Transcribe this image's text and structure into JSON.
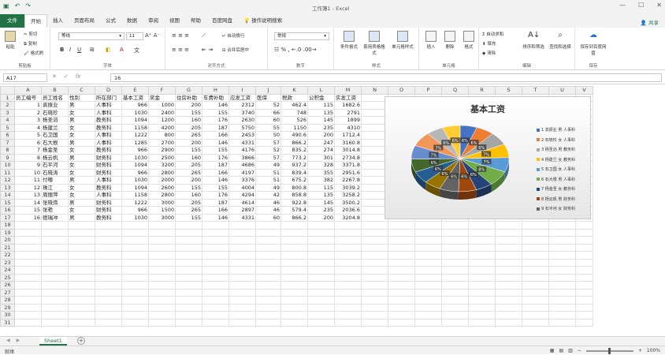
{
  "window": {
    "title": "工作簿1 - Excel"
  },
  "menu": [
    "文件",
    "开始",
    "插入",
    "页面布局",
    "公式",
    "数据",
    "审阅",
    "视图",
    "帮助",
    "百度网盘",
    "操作说明搜索"
  ],
  "share_label": "共享",
  "ribbon": {
    "clipboard": {
      "cut": "剪切",
      "copy": "复制",
      "painter": "格式刷",
      "paste": "粘贴",
      "label": "剪贴板"
    },
    "font": {
      "name": "等线",
      "size": "11",
      "label": "字体"
    },
    "align": {
      "wrap": "自动换行",
      "merge": "合并后居中",
      "label": "对齐方式"
    },
    "number": {
      "format": "常规",
      "label": "数字"
    },
    "styles": {
      "cond": "条件格式",
      "table": "套用表格格式",
      "cell": "单元格样式",
      "label": "样式"
    },
    "cells": {
      "insert": "插入",
      "delete": "删除",
      "format": "格式",
      "label": "单元格"
    },
    "edit": {
      "sum": "自动求和",
      "fill": "填充",
      "clear": "清除",
      "sort": "排序和筛选",
      "find": "查找和选择",
      "label": "编辑"
    },
    "save": {
      "btn": "保存到百度网盘",
      "label": "保存"
    }
  },
  "formula": {
    "namebox": "A17",
    "content": "16"
  },
  "columns": [
    "A",
    "B",
    "C",
    "D",
    "E",
    "F",
    "G",
    "H",
    "I",
    "J",
    "K",
    "L",
    "M",
    "N",
    "O",
    "P",
    "Q",
    "R",
    "S",
    "T",
    "U",
    "V"
  ],
  "headers": [
    "员工编号",
    "员工姓名",
    "性别",
    "所在部门",
    "基本工资",
    "奖金",
    "住房补助",
    "车费补助",
    "应发工资",
    "医保",
    "税款",
    "公积金",
    "实发工资"
  ],
  "rows": [
    [
      "1",
      "袁振业",
      "男",
      "人事科",
      "966",
      "1000",
      "200",
      "146",
      "2312",
      "52",
      "462.4",
      "115",
      "1682.6"
    ],
    [
      "2",
      "石晓珍",
      "女",
      "人事科",
      "1030",
      "2400",
      "155",
      "155",
      "3740",
      "66",
      "748",
      "135",
      "2791"
    ],
    [
      "3",
      "杨圣滔",
      "男",
      "教务科",
      "1094",
      "1200",
      "160",
      "176",
      "2630",
      "60",
      "526",
      "145",
      "1899"
    ],
    [
      "4",
      "杨建兰",
      "女",
      "教务科",
      "1158",
      "4200",
      "205",
      "187",
      "5750",
      "55",
      "1150",
      "235",
      "4310"
    ],
    [
      "5",
      "石卫国",
      "女",
      "人事科",
      "1222",
      "800",
      "265",
      "166",
      "2453",
      "50",
      "490.6",
      "200",
      "1712.4"
    ],
    [
      "6",
      "石大根",
      "男",
      "人事科",
      "1285",
      "2700",
      "200",
      "146",
      "4331",
      "57",
      "866.2",
      "247",
      "3160.8"
    ],
    [
      "7",
      "杨金圣",
      "女",
      "教务科",
      "966",
      "2900",
      "155",
      "155",
      "4176",
      "52",
      "835.2",
      "274",
      "3014.8"
    ],
    [
      "8",
      "杨云帆",
      "男",
      "财务科",
      "1030",
      "2500",
      "160",
      "176",
      "3866",
      "57",
      "773.2",
      "301",
      "2734.8"
    ],
    [
      "9",
      "石平河",
      "女",
      "财务科",
      "1094",
      "3200",
      "205",
      "187",
      "4686",
      "49",
      "937.2",
      "328",
      "3371.8"
    ],
    [
      "10",
      "石晓涛",
      "女",
      "财务科",
      "966",
      "2800",
      "265",
      "166",
      "4197",
      "51",
      "839.4",
      "355",
      "2951.6"
    ],
    [
      "11",
      "付嘟",
      "男",
      "人事科",
      "1030",
      "2000",
      "200",
      "146",
      "3376",
      "51",
      "675.2",
      "382",
      "2267.8"
    ],
    [
      "12",
      "珠江",
      "女",
      "教务科",
      "1094",
      "2600",
      "155",
      "155",
      "4004",
      "49",
      "800.8",
      "115",
      "3039.2"
    ],
    [
      "13",
      "周丽萍",
      "女",
      "人事科",
      "1158",
      "2800",
      "160",
      "176",
      "4294",
      "42",
      "858.8",
      "135",
      "3258.2"
    ],
    [
      "14",
      "张晓伟",
      "男",
      "财务科",
      "1222",
      "3000",
      "205",
      "187",
      "4614",
      "46",
      "922.8",
      "145",
      "3500.2"
    ],
    [
      "15",
      "张艳",
      "女",
      "财务科",
      "966",
      "1500",
      "265",
      "166",
      "2897",
      "46",
      "579.4",
      "235",
      "2036.6"
    ],
    [
      "16",
      "德瑞冲",
      "男",
      "教务科",
      "1030",
      "3000",
      "155",
      "146",
      "4331",
      "60",
      "866.2",
      "200",
      "3204.8"
    ]
  ],
  "chart_data": {
    "type": "pie",
    "title": "基本工资",
    "categories": [
      "1 袁振业 男 人事科",
      "2 石晓珍 女 人事科",
      "3 杨圣滔 男 教务科",
      "4 杨建兰 女 教务科",
      "5 石卫国 女 人事科",
      "6 石大根 男 人事科",
      "7 杨金圣 女 教务科",
      "8 杨云帆 男 财务科",
      "9 石平河 女 财务科"
    ],
    "values": [
      966,
      1030,
      1094,
      1158,
      1222,
      1285,
      966,
      1030,
      1094,
      966,
      1030,
      1094,
      1158,
      1222,
      966,
      1030
    ],
    "data_labels": [
      "6%",
      "6%",
      "6%",
      "7%",
      "7%",
      "8%",
      "6%",
      "6%",
      "6%",
      "6%",
      "6%",
      "6%",
      "7%",
      "7%",
      "6%",
      "6%"
    ],
    "colors": [
      "#4472c4",
      "#ed7d31",
      "#a5a5a5",
      "#ffc000",
      "#5b9bd5",
      "#70ad47",
      "#264478",
      "#9e480e",
      "#636363",
      "#997300",
      "#255e91",
      "#43682b",
      "#698ed0",
      "#f1975a",
      "#b7b7b7",
      "#ffcd33"
    ],
    "legend_position": "right"
  },
  "sheet_tab": "Sheet1",
  "status": {
    "text": "就绪",
    "zoom": "100%"
  }
}
